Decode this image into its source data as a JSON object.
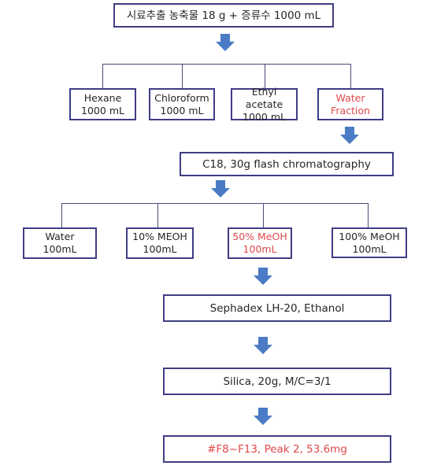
{
  "diagram": {
    "start": {
      "label": "시료추출 농축물 18 g + 증류수 1000 mL"
    },
    "solvent_partition": [
      {
        "line1": "Hexane",
        "line2": "1000 mL",
        "highlight": false
      },
      {
        "line1": "Chloroform",
        "line2": "1000 mL",
        "highlight": false
      },
      {
        "line1": "Ethyl acetate",
        "line2": "1000 mL",
        "highlight": false
      },
      {
        "line1": "Water",
        "line2": "Fraction",
        "highlight": true
      }
    ],
    "flash_step": {
      "label": "C18, 30g flash chromatography"
    },
    "flash_fractions": [
      {
        "line1": "Water",
        "line2": "100mL",
        "highlight": false
      },
      {
        "line1": "10% MEOH",
        "line2": "100mL",
        "highlight": false
      },
      {
        "line1": "50% MeOH",
        "line2": "100mL",
        "highlight": true
      },
      {
        "line1": "100% MeOH",
        "line2": "100mL",
        "highlight": false
      }
    ],
    "sephadex_step": {
      "label": "Sephadex LH-20, Ethanol"
    },
    "silica_step": {
      "label": "Silica, 20g, M/C=3/1"
    },
    "result": {
      "label": "#F8~F13, Peak 2, 53.6mg",
      "highlight": true
    },
    "colors": {
      "arrow": "#4a7bc4",
      "box_border": "#3f3d85",
      "highlight_text": "#e0484a",
      "connector": "#4b4a7a"
    },
    "icons": {
      "arrow": "down-arrow-icon"
    }
  }
}
